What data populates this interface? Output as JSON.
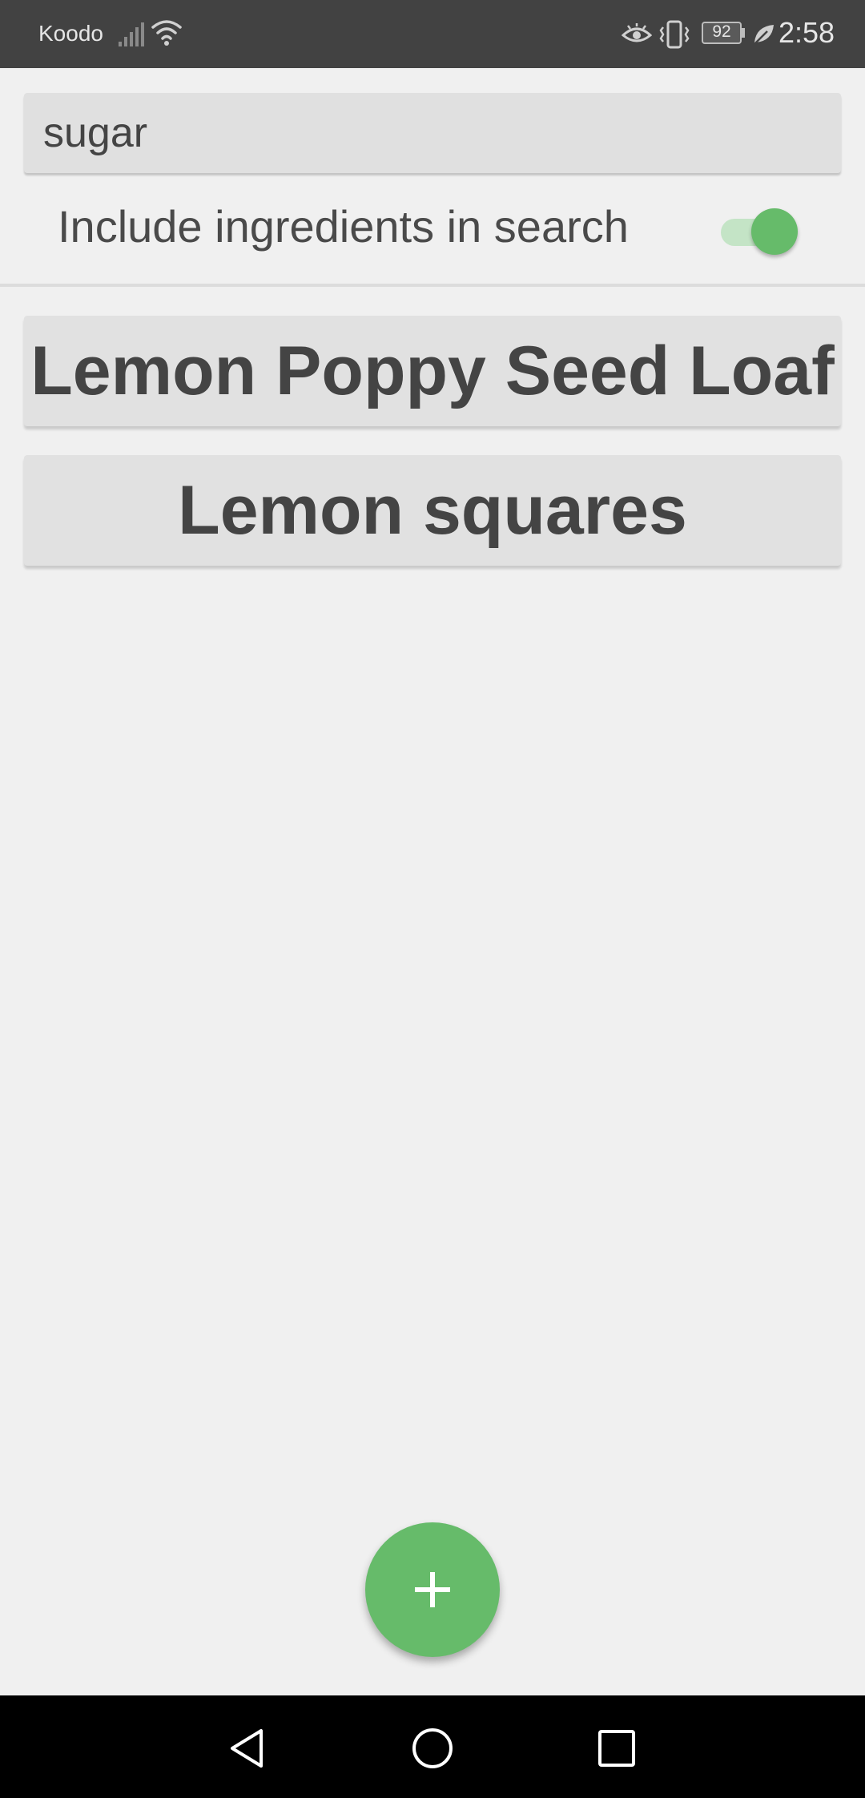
{
  "status_bar": {
    "carrier": "Koodo",
    "battery_level": "92",
    "time": "2:58",
    "icons": [
      "signal-icon",
      "wifi-icon",
      "eye-icon",
      "vibrate-icon",
      "battery-icon",
      "leaf-icon"
    ]
  },
  "search": {
    "value": "sugar"
  },
  "toggle": {
    "label": "Include ingredients in search",
    "checked": true
  },
  "recipes": [
    {
      "title": "Lemon Poppy Seed Loaf"
    },
    {
      "title": "Lemon squares"
    }
  ],
  "fab": {
    "icon": "plus-icon"
  },
  "nav_bar": {
    "icons": [
      "back-icon",
      "home-icon",
      "recents-icon"
    ]
  },
  "colors": {
    "accent": "#66bb6a",
    "accent_light": "#c4e4c6",
    "status_bar": "#424242",
    "background": "#f0f0f0",
    "button": "#e1e1e1",
    "text": "#444444"
  }
}
